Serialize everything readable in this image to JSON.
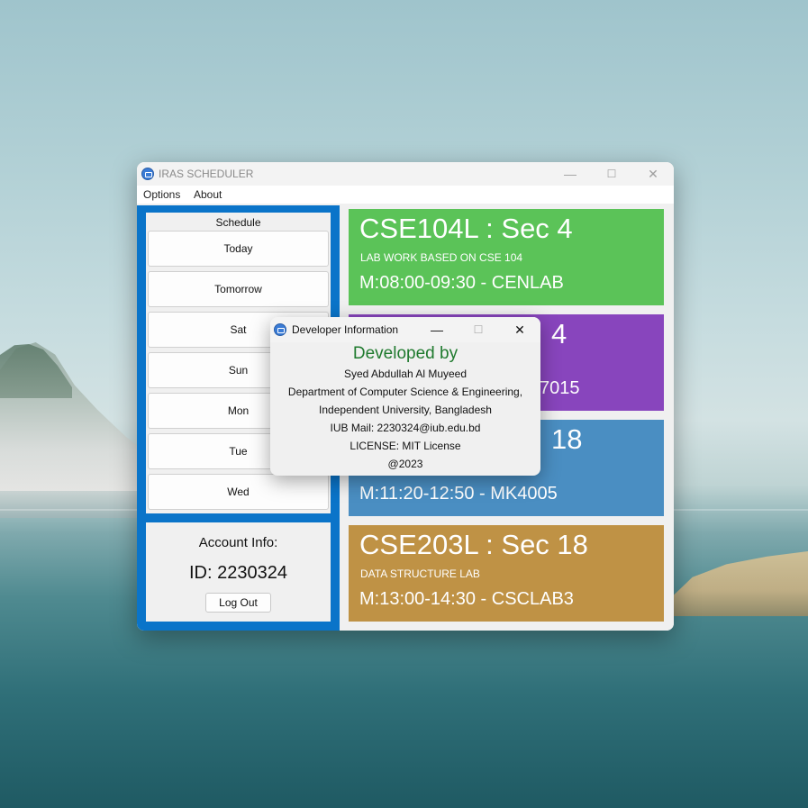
{
  "window": {
    "title": "IRAS SCHEDULER",
    "controls": {
      "minimize": "—",
      "maximize": "☐",
      "close": "✕"
    }
  },
  "menu": {
    "items": [
      "Options",
      "About"
    ]
  },
  "sidebar": {
    "schedule_label": "Schedule",
    "days": [
      "Today",
      "Tomorrow",
      "Sat",
      "Sun",
      "Mon",
      "Tue",
      "Wed"
    ]
  },
  "account": {
    "title": "Account Info:",
    "id_text": "ID: 2230324",
    "logout_label": "Log Out"
  },
  "courses": [
    {
      "title": "CSE104L : Sec 4",
      "description": "LAB WORK BASED ON CSE 104",
      "time": "M:08:00-09:30 - CENLAB",
      "color": "#5bc358"
    },
    {
      "title": "4",
      "description": "",
      "time": "7015",
      "color": "#8845bd"
    },
    {
      "title": "18",
      "description": "",
      "time": "M:11:20-12:50 - MK4005",
      "color": "#4a8ec2"
    },
    {
      "title": "CSE203L : Sec 18",
      "description": "DATA STRUCTURE LAB",
      "time": "M:13:00-14:30 - CSCLAB3",
      "color": "#bf9245"
    }
  ],
  "dialog": {
    "title": "Developer Information",
    "controls": {
      "minimize": "—",
      "maximize": "☐",
      "close": "✕"
    },
    "heading": "Developed by",
    "lines": [
      "Syed Abdullah Al Muyeed",
      "Department of Computer Science & Engineering,",
      "Independent University, Bangladesh",
      "IUB Mail: 2230324@iub.edu.bd",
      "LICENSE: MIT License",
      "@2023"
    ]
  },
  "colors": {
    "sidebar": "#0a74c9",
    "heading_green": "#1f7a2e"
  }
}
